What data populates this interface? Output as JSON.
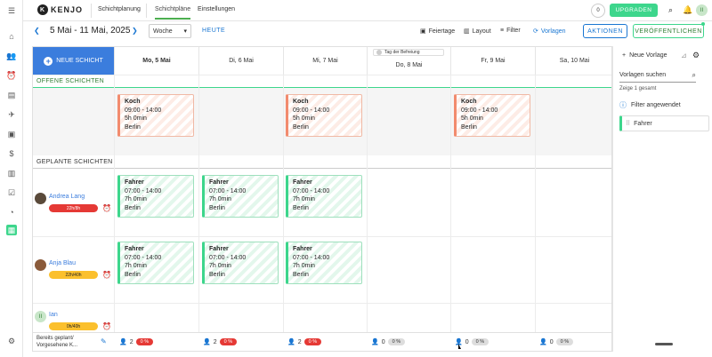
{
  "app": {
    "brand": "KENJO",
    "brand_icon": "K"
  },
  "topnav": {
    "section": "Schichtplanung",
    "tabs": [
      "Schichtpläne",
      "Einstellungen"
    ],
    "notification_count": "0",
    "upgrade_label": "UPGRADEN",
    "user_initials": "II"
  },
  "toolbar": {
    "date_range": "5 Mai - 11 Mai, 2025",
    "view_select": "Woche",
    "today_label": "HEUTE",
    "holidays_label": "Feiertage",
    "layout_label": "Layout",
    "filter_label": "Filter",
    "templates_label": "Vorlagen",
    "actions_label": "AKTIONEN",
    "publish_label": "VERÖFFENTLICHEN"
  },
  "grid": {
    "new_shift_label": "NEUE SCHICHT",
    "holiday_toggle_label": "Tag der Befreiung",
    "days": [
      "Mo, 5 Mai",
      "Di, 6 Mai",
      "Mi, 7 Mai",
      "Do, 8 Mai",
      "Fr, 9 Mai",
      "Sa, 10 Mai"
    ],
    "open_section_label": "OFFENE SCHICHTEN",
    "planned_section_label": "GEPLANTE SCHICHTEN",
    "open_shifts": [
      {
        "day": 0,
        "title": "Koch",
        "time": "09:00 - 14:00",
        "duration": "5h 0min",
        "location": "Berlin"
      },
      {
        "day": 2,
        "title": "Koch",
        "time": "09:00 - 14:00",
        "duration": "5h 0min",
        "location": "Berlin"
      },
      {
        "day": 4,
        "title": "Koch",
        "time": "09:00 - 14:00",
        "duration": "5h 0min",
        "location": "Berlin"
      }
    ],
    "employees": [
      {
        "name": "Andrea Lang",
        "hours": "22h/8h",
        "pill_color": "#e53935"
      },
      {
        "name": "Anja Blau",
        "hours": "22h/40h",
        "pill_color": "#fbc02d"
      },
      {
        "name": "Ian",
        "hours": "0h/40h",
        "pill_color": "#fbc02d"
      }
    ],
    "driver_shift": {
      "title": "Fahrer",
      "time": "07:00 - 14:00",
      "duration": "7h 0min",
      "location": "Berlin"
    },
    "footer_label": "Bereits geplant/ Vorgesehene K...",
    "footer": [
      {
        "count": "2",
        "pct": "0 %",
        "color": "red"
      },
      {
        "count": "2",
        "pct": "0 %",
        "color": "red"
      },
      {
        "count": "2",
        "pct": "0 %",
        "color": "red"
      },
      {
        "count": "0",
        "pct": "0 %",
        "color": "grey"
      },
      {
        "count": "0",
        "pct": "0 %",
        "color": "grey"
      },
      {
        "count": "0",
        "pct": "0 %",
        "color": "grey"
      }
    ]
  },
  "templates_panel": {
    "new_template_label": "Neue Vorlage",
    "search_placeholder": "Vorlagen suchen",
    "count_label": "Zeige 1 gesamt",
    "filter_applied_label": "Filter angewendet",
    "items": [
      "Fahrer"
    ]
  }
}
